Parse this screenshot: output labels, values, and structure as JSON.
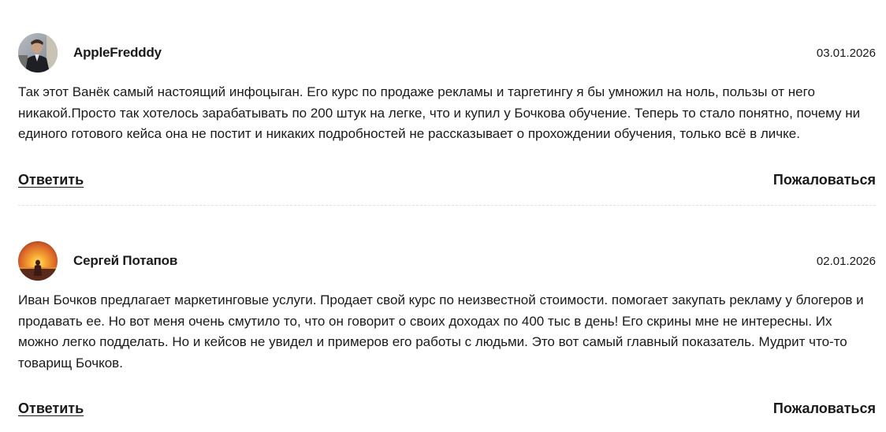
{
  "comments": [
    {
      "author": "AppleFredddy",
      "date": "03.01.2026",
      "text": "Так этот Ванёк самый настоящий инфоцыган. Его курс по продаже рекламы и таргетингу я бы умножил на ноль, пользы от него никакой.Просто так хотелось зарабатывать по 200 штук на легке, что и купил у Бочкова обучение. Теперь то стало понятно, почему ни единого готового кейса она не постит и никаких подробностей не рассказывает о прохождении обучения, только всё в личке.",
      "reply_label": "Ответить",
      "report_label": "Пожаловаться",
      "avatar_icon": "user-photo-icon"
    },
    {
      "author": "Сергей Потапов",
      "date": "02.01.2026",
      "text": "Иван Бочков предлагает маркетинговые услуги. Продает свой курс по неизвестной стоимости. помогает закупать рекламу у блогеров и продавать ее. Но вот меня очень смутило то, что он говорит о своих доходах по 400 тыс в день! Его скрины мне не интересны. Их можно легко подделать. Но и кейсов не увидел и примеров его работы с людьми. Это вот самый главный показатель. Мудрит что-то товарищ Бочков.",
      "reply_label": "Ответить",
      "report_label": "Пожаловаться",
      "avatar_icon": "sunset-photo-icon"
    }
  ],
  "colors": {
    "text": "#1a1a1a",
    "divider": "#e2e2e2",
    "background": "#ffffff"
  }
}
